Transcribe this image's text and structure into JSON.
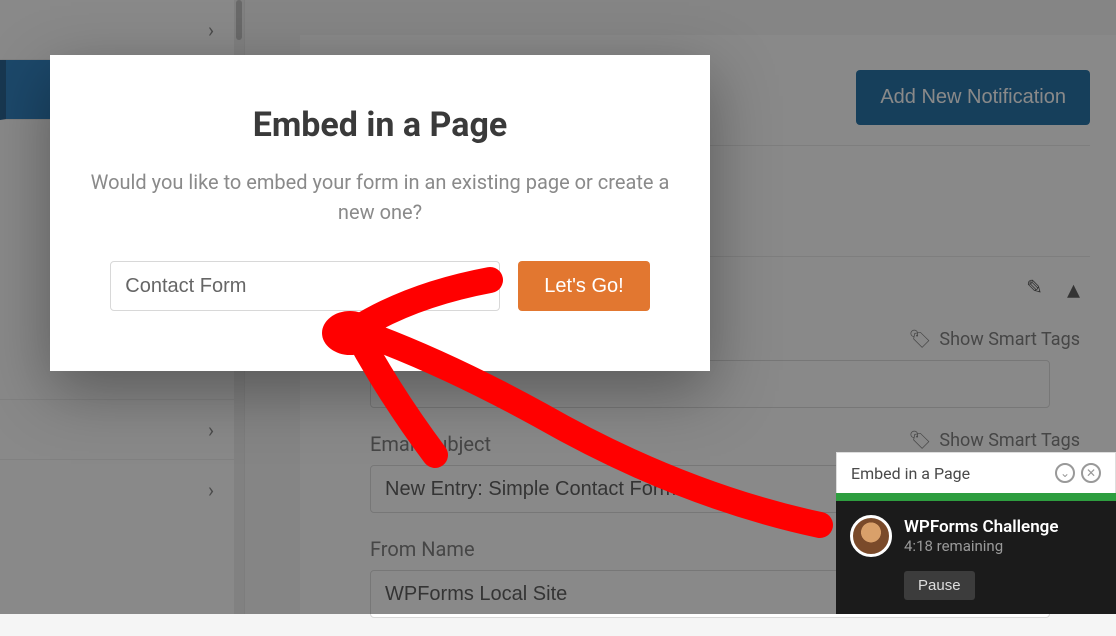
{
  "modal": {
    "title": "Embed in a Page",
    "description": "Would you like to embed your form in an existing page or create a new one?",
    "input_value": "Contact Form",
    "go_label": "Let's Go!"
  },
  "header": {
    "add_notification_label": "Add New Notification"
  },
  "notifications": {
    "smart_tags_label": "Show Smart Tags",
    "email_subject_label": "Email Subject",
    "email_subject_value": "New Entry: Simple Contact Form",
    "from_name_label": "From Name",
    "from_name_value": "WPForms Local Site"
  },
  "challenge": {
    "header": "Embed in a Page",
    "title": "WPForms Challenge",
    "remaining": "4:18 remaining",
    "pause_label": "Pause"
  },
  "icons": {
    "chevron": "›",
    "pencil": "✎",
    "caret_up": "▴",
    "tag": "🏷",
    "minimize": "⌄",
    "close": "✕"
  }
}
